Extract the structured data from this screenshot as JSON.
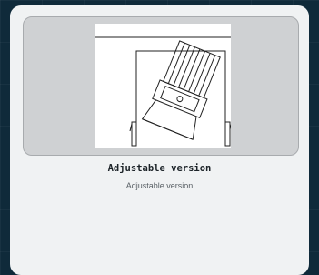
{
  "product_card": {
    "image_label": "Adjustable downlight technical drawing",
    "title": "Adjustable version",
    "subtitle": "Adjustable version"
  },
  "colors": {
    "page_background": "#0f2a3a",
    "card_background": "#f0f2f3",
    "image_panel_background": "#cfd1d3",
    "title_color": "#1c2328",
    "subtitle_color": "#5a6166"
  }
}
